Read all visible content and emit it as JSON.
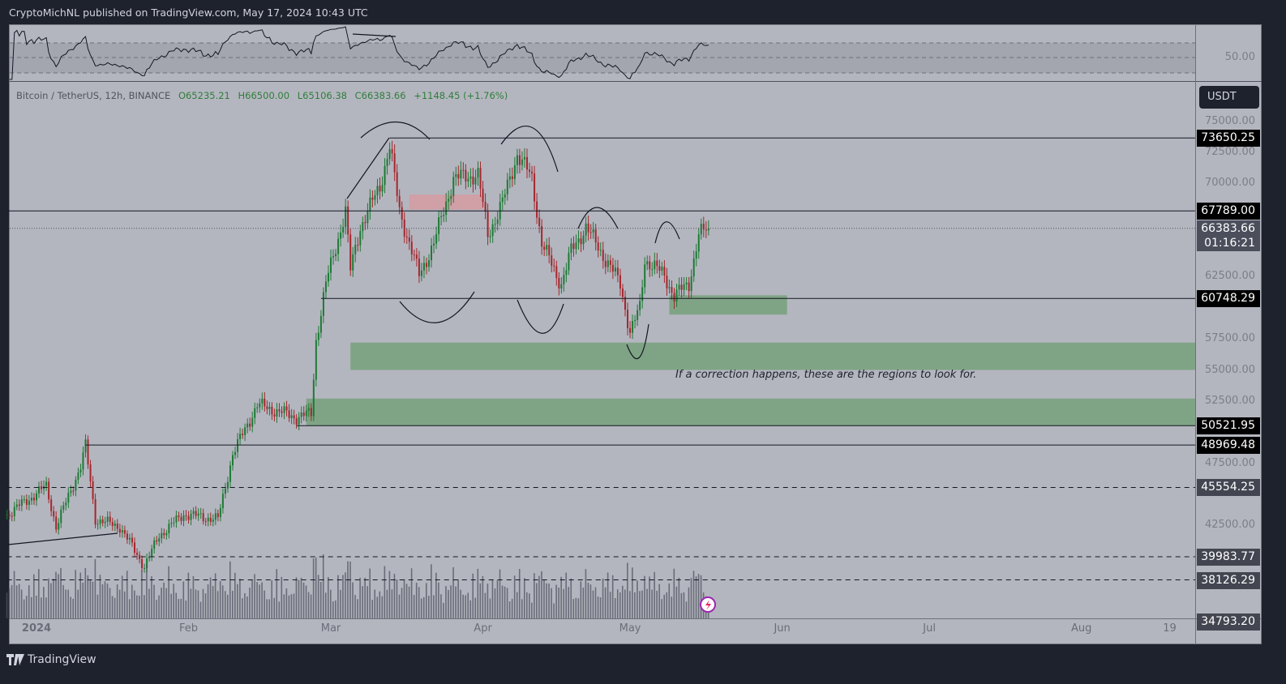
{
  "header": {
    "published": "CryptoMichNL published on TradingView.com, May 17, 2024 10:43 UTC"
  },
  "legend": {
    "symbol": "Bitcoin / TetherUS, 12h, BINANCE",
    "open": "O65235.21",
    "high": "H66500.00",
    "low": "L65106.38",
    "close": "C66383.66",
    "change": "+1148.45 (+1.76%)"
  },
  "currency_button": "USDT",
  "rsi_pane": {
    "label_50": "50.00",
    "upper": 70,
    "lower": 30
  },
  "colors": {
    "background": "#1e222d",
    "pane": "#b4b6bf",
    "up": "#1d7a35",
    "down": "#a5262d",
    "zone_green": "#6e9e72",
    "zone_red": "#d89aa0"
  },
  "chart_data": {
    "type": "candlestick",
    "timeframe": "12h",
    "ylim": [
      34000,
      77000
    ],
    "y_ticks": [
      "75000.00",
      "72500.00",
      "70000.00",
      "62500.00",
      "57500.00",
      "55000.00",
      "52500.00",
      "47500.00",
      "42500.00"
    ],
    "x_ticks": [
      {
        "label": "2024",
        "date": "2024-01-01"
      },
      {
        "label": "Feb",
        "date": "2024-02-01"
      },
      {
        "label": "Mar",
        "date": "2024-03-01"
      },
      {
        "label": "Apr",
        "date": "2024-04-01"
      },
      {
        "label": "May",
        "date": "2024-05-01"
      },
      {
        "label": "Jun",
        "date": "2024-06-01"
      },
      {
        "label": "Jul",
        "date": "2024-07-01"
      },
      {
        "label": "Aug",
        "date": "2024-08-01"
      },
      {
        "label": "19",
        "date": "2024-08-19"
      }
    ],
    "price_path": [
      [
        "2023-12-26",
        43370
      ],
      [
        "2024-01-03",
        45650
      ],
      [
        "2024-01-05",
        42400
      ],
      [
        "2024-01-10",
        47270
      ],
      [
        "2024-01-11",
        48900
      ],
      [
        "2024-01-13",
        43000
      ],
      [
        "2024-01-18",
        42400
      ],
      [
        "2024-01-23",
        39200
      ],
      [
        "2024-01-26",
        41700
      ],
      [
        "2024-01-31",
        43400
      ],
      [
        "2024-02-07",
        43000
      ],
      [
        "2024-02-10",
        48250
      ],
      [
        "2024-02-15",
        52200
      ],
      [
        "2024-02-23",
        51200
      ],
      [
        "2024-02-26",
        51500
      ],
      [
        "2024-02-27",
        57400
      ],
      [
        "2024-02-29",
        61950
      ],
      [
        "2024-03-04",
        67800
      ],
      [
        "2024-03-05",
        63000
      ],
      [
        "2024-03-07",
        66500
      ],
      [
        "2024-03-11",
        69750
      ],
      [
        "2024-03-13",
        73000
      ],
      [
        "2024-03-15",
        67800
      ],
      [
        "2024-03-19",
        62600
      ],
      [
        "2024-03-22",
        65200
      ],
      [
        "2024-03-26",
        70400
      ],
      [
        "2024-03-31",
        70700
      ],
      [
        "2024-04-02",
        65850
      ],
      [
        "2024-04-05",
        68450
      ],
      [
        "2024-04-08",
        72350
      ],
      [
        "2024-04-11",
        70400
      ],
      [
        "2024-04-13",
        65200
      ],
      [
        "2024-04-16",
        62600
      ],
      [
        "2024-04-17",
        61950
      ],
      [
        "2024-04-19",
        64550
      ],
      [
        "2024-04-22",
        66500
      ],
      [
        "2024-04-26",
        63900
      ],
      [
        "2024-04-29",
        61950
      ],
      [
        "2024-05-01",
        58000
      ],
      [
        "2024-05-03",
        60000
      ],
      [
        "2024-05-04",
        63900
      ],
      [
        "2024-05-08",
        62600
      ],
      [
        "2024-05-10",
        60950
      ],
      [
        "2024-05-13",
        61950
      ],
      [
        "2024-05-15",
        65850
      ],
      [
        "2024-05-17",
        66383.66
      ]
    ],
    "current_price": {
      "value": 66383.66,
      "label": "66383.66",
      "countdown": "01:16:21"
    },
    "levels": [
      {
        "label": "73650.25",
        "value": 73650.25,
        "style": "solid",
        "from": "2024-03-13",
        "box": "black"
      },
      {
        "label": "67789.00",
        "value": 67789.0,
        "style": "solid",
        "from": "2023-12-26",
        "box": "black"
      },
      {
        "label": "60748.29",
        "value": 60748.29,
        "style": "solid",
        "from": "2024-02-28",
        "box": "black"
      },
      {
        "label": "50521.95",
        "value": 50521.95,
        "style": "solid",
        "from": "2024-02-23",
        "box": "black"
      },
      {
        "label": "48969.48",
        "value": 48969.48,
        "style": "solid",
        "from": "2024-01-11",
        "box": "black"
      },
      {
        "label": "45554.25",
        "value": 45554.25,
        "style": "dashed",
        "from": "2023-12-26",
        "box": "gray"
      },
      {
        "label": "39983.77",
        "value": 39983.77,
        "style": "dashed",
        "from": "2023-12-26",
        "box": "gray"
      },
      {
        "label": "38126.29",
        "value": 38126.29,
        "style": "dashed",
        "from": "2023-12-26",
        "box": "gray"
      },
      {
        "label": "34793.20",
        "value": 34793.2,
        "style": "none",
        "box": "gray"
      }
    ],
    "zones": [
      {
        "type": "support",
        "from": "2024-03-05",
        "to": "end",
        "top": 57200,
        "bottom": 55000
      },
      {
        "type": "support",
        "from": "2024-02-25",
        "to": "end",
        "top": 52700,
        "bottom": 50500
      },
      {
        "type": "support",
        "from": "2024-05-09",
        "to": "2024-06-02",
        "top": 61000,
        "bottom": 59450
      },
      {
        "type": "resistance",
        "from": "2024-03-17",
        "to": "2024-04-01",
        "top": 69100,
        "bottom": 67900
      }
    ],
    "annotation": "If a correction happens, these are the regions to look for."
  },
  "footer": {
    "brand": "TradingView"
  }
}
